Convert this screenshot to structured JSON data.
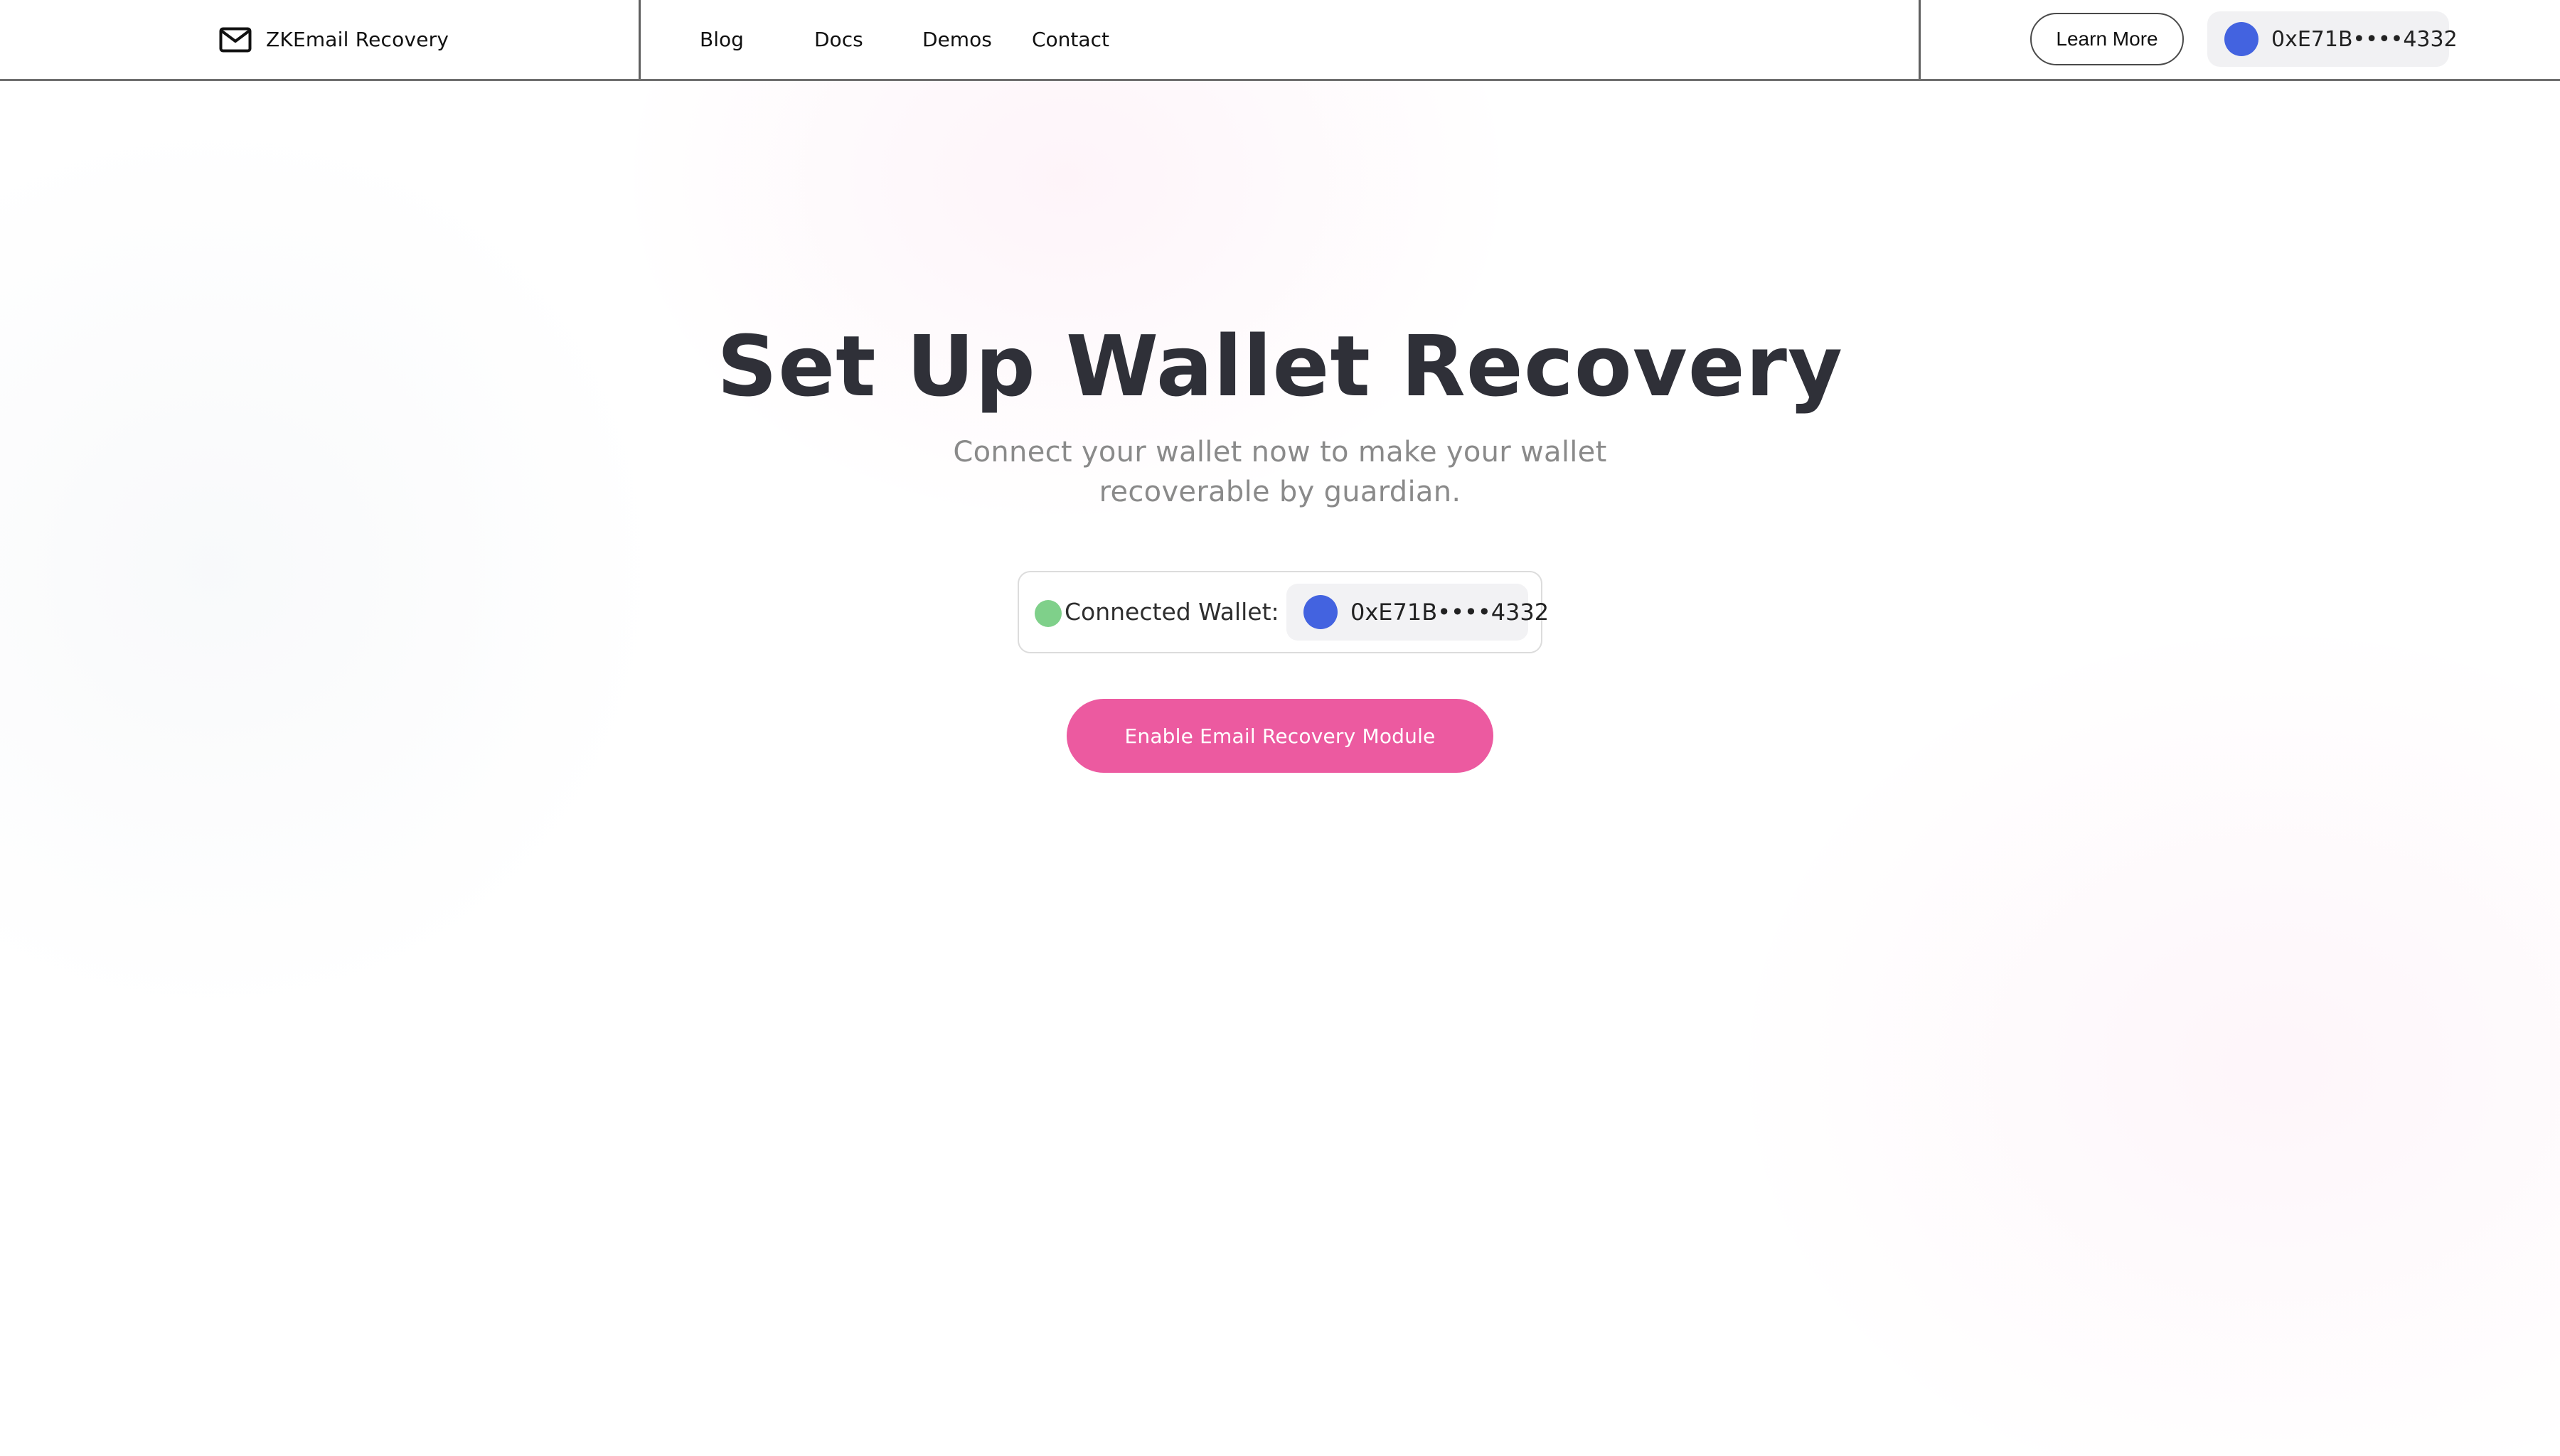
{
  "colors": {
    "accent": "#ec5aa0",
    "wallet_avatar": "#4363e0",
    "status_connected": "#7fd08a"
  },
  "header": {
    "brand": {
      "icon": "mail-icon",
      "label": "ZKEmail Recovery"
    },
    "nav": [
      {
        "label": "Blog"
      },
      {
        "label": "Docs"
      },
      {
        "label": "Demos"
      },
      {
        "label": "Contact"
      }
    ],
    "learn_more_label": "Learn More",
    "wallet": {
      "avatar_icon": "wallet-avatar-icon",
      "address": "0xE71B••••4332"
    }
  },
  "main": {
    "title": "Set Up Wallet Recovery",
    "subtitle": "Connect your wallet now to make your wallet recoverable by guardian.",
    "connected_wallet": {
      "status": "connected",
      "status_icon": "status-dot-icon",
      "label": "Connected Wallet:",
      "avatar_icon": "wallet-avatar-icon",
      "address": "0xE71B••••4332"
    },
    "primary_button_label": "Enable Email Recovery Module"
  }
}
